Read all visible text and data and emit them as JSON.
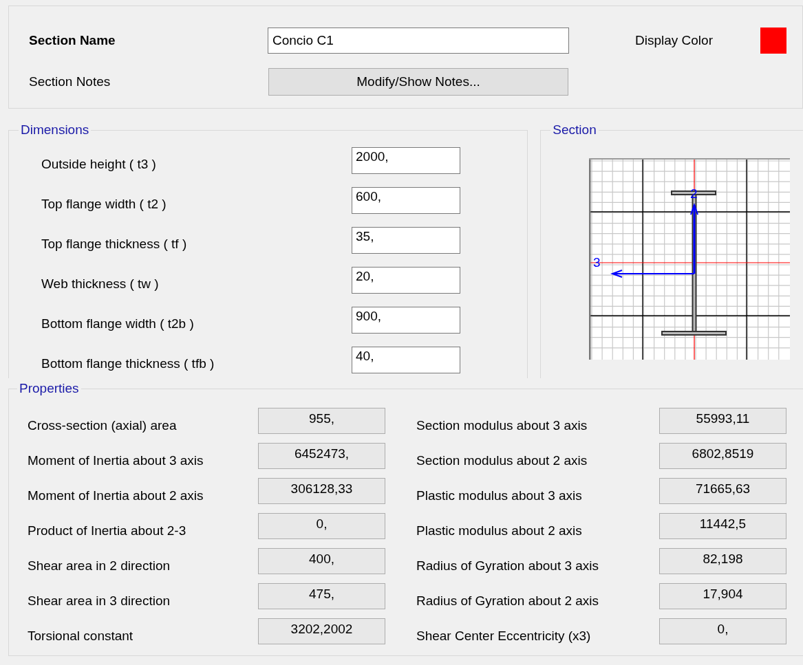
{
  "header": {
    "name_label": "Section Name",
    "name_value": "Concio C1",
    "display_color": {
      "label": "Display Color",
      "color": "#ff0000"
    },
    "notes_label": "Section Notes",
    "notes_button": "Modify/Show Notes..."
  },
  "dimensions": {
    "title": "Dimensions",
    "fields": [
      {
        "label": "Outside height  ( t3 )",
        "value": "2000,"
      },
      {
        "label": "Top flange width  ( t2 )",
        "value": "600,"
      },
      {
        "label": "Top flange thickness  ( tf )",
        "value": "35,"
      },
      {
        "label": "Web thickness  ( tw )",
        "value": "20,"
      },
      {
        "label": "Bottom flange width  ( t2b )",
        "value": "900,"
      },
      {
        "label": "Bottom flange thickness  ( tfb )",
        "value": "40,"
      }
    ]
  },
  "section": {
    "title": "Section",
    "axis_2_label": "2",
    "axis_3_label": "3"
  },
  "properties": {
    "title": "Properties",
    "left": [
      {
        "label": "Cross-section (axial) area",
        "value": "955,"
      },
      {
        "label": "Moment of Inertia about 3 axis",
        "value": "6452473,"
      },
      {
        "label": "Moment of Inertia about 2 axis",
        "value": "306128,33"
      },
      {
        "label": "Product of Inertia about 2-3",
        "value": "0,"
      },
      {
        "label": "Shear area in 2 direction",
        "value": "400,"
      },
      {
        "label": "Shear area in 3 direction",
        "value": "475,"
      },
      {
        "label": "Torsional constant",
        "value": "3202,2002"
      }
    ],
    "right": [
      {
        "label": "Section modulus about 3 axis",
        "value": "55993,11"
      },
      {
        "label": "Section modulus about 2 axis",
        "value": "6802,8519"
      },
      {
        "label": "Plastic modulus about 3 axis",
        "value": "71665,63"
      },
      {
        "label": "Plastic modulus about 2 axis",
        "value": "11442,5"
      },
      {
        "label": "Radius of Gyration about 3 axis",
        "value": "82,198"
      },
      {
        "label": "Radius of Gyration about 2 axis",
        "value": "17,904"
      },
      {
        "label": "Shear Center Eccentricity (x3)",
        "value": "0,"
      }
    ]
  }
}
